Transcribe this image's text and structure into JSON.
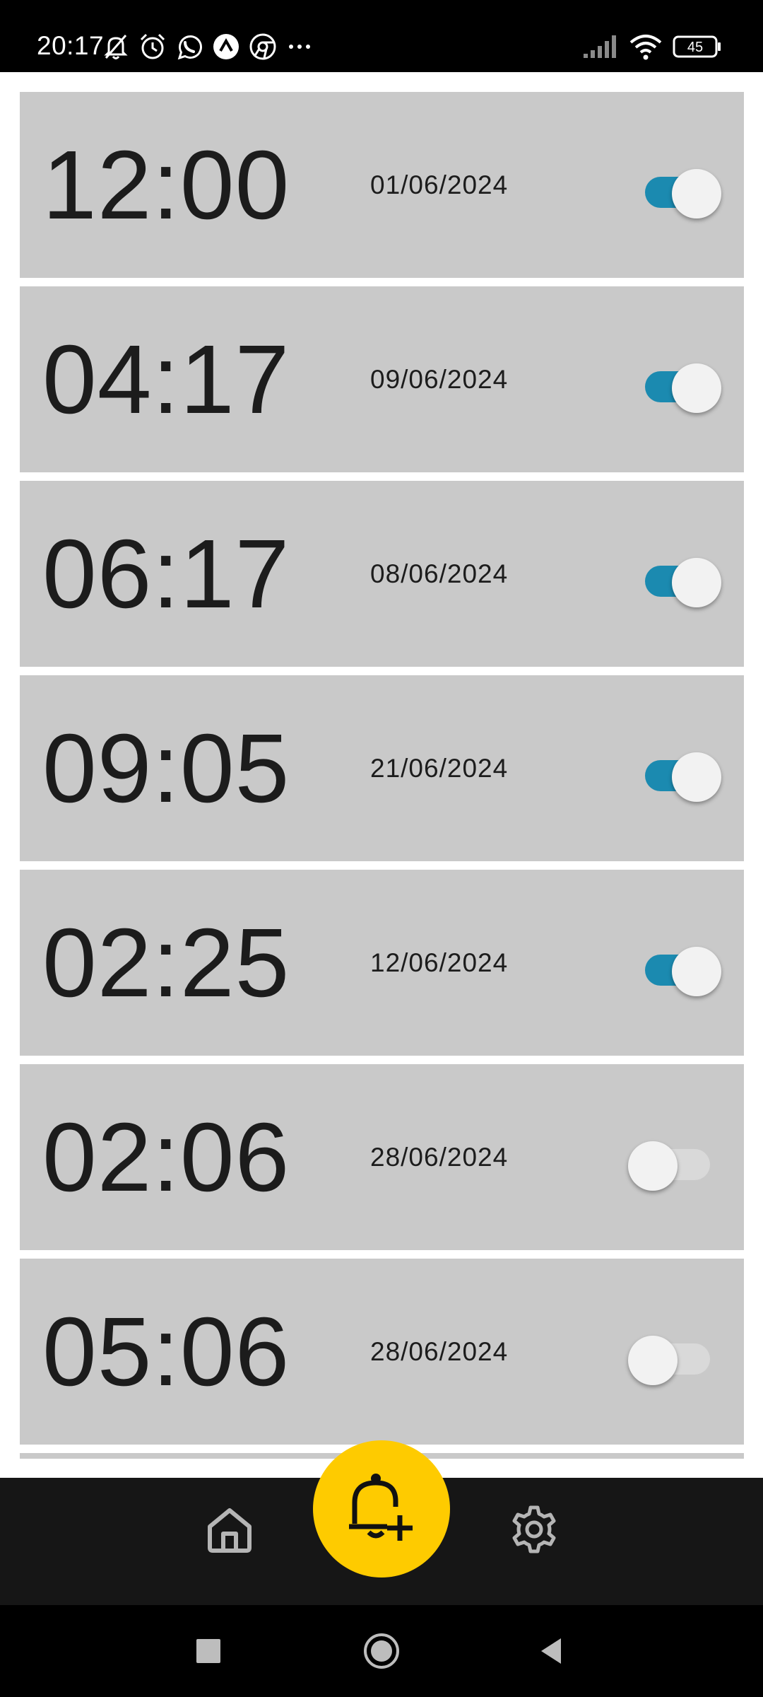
{
  "status_bar": {
    "time": "20:17",
    "battery": "45",
    "icons": [
      "muted-bell-icon",
      "alarm-clock-icon",
      "whatsapp-icon",
      "arc-icon",
      "chrome-icon",
      "more-dots-icon",
      "signal-icon",
      "wifi-icon",
      "battery-icon"
    ]
  },
  "alarms": [
    {
      "time": "12:00",
      "date": "01/06/2024",
      "enabled": true
    },
    {
      "time": "04:17",
      "date": "09/06/2024",
      "enabled": true
    },
    {
      "time": "06:17",
      "date": "08/06/2024",
      "enabled": true
    },
    {
      "time": "09:05",
      "date": "21/06/2024",
      "enabled": true
    },
    {
      "time": "02:25",
      "date": "12/06/2024",
      "enabled": true
    },
    {
      "time": "02:06",
      "date": "28/06/2024",
      "enabled": false
    },
    {
      "time": "05:06",
      "date": "28/06/2024",
      "enabled": false
    }
  ],
  "bottom_nav": {
    "items": [
      "home-icon",
      "add-alarm-icon",
      "settings-icon"
    ]
  },
  "system_nav": {
    "items": [
      "recents-icon",
      "home-circle-icon",
      "back-triangle-icon"
    ]
  },
  "colors": {
    "card_background": "#c9c9c9",
    "toggle_on": "#1b8ab0",
    "toggle_off_track": "#d9d9d9",
    "fab": "#fecb00",
    "nav_background": "#161616",
    "status_bar": "#000000"
  }
}
